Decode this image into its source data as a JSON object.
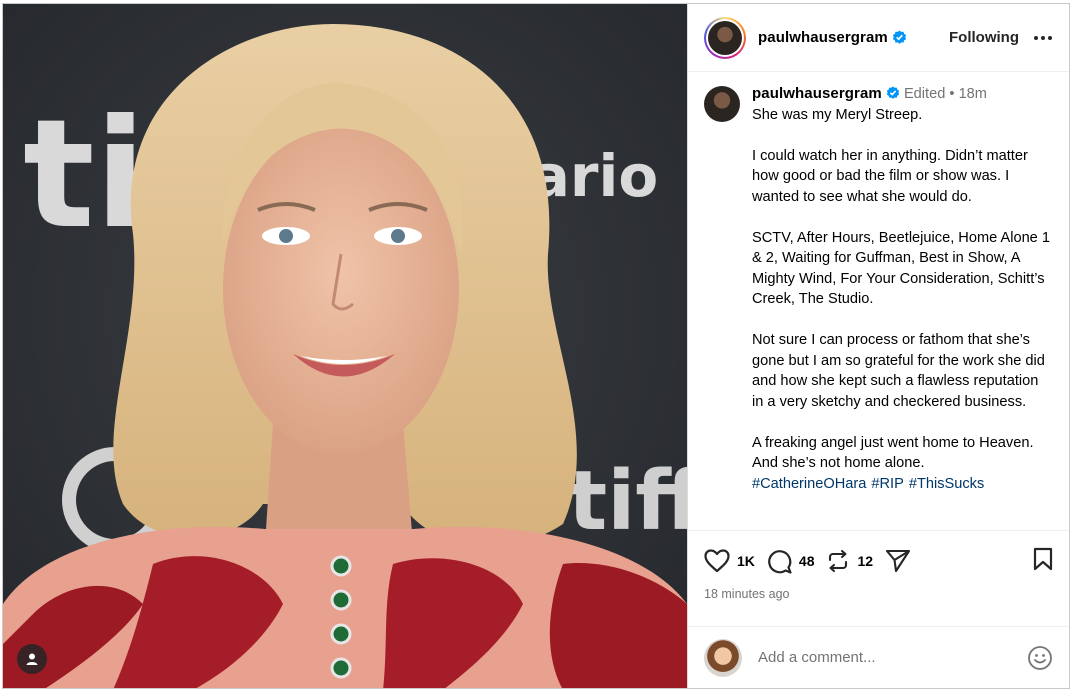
{
  "photo": {
    "backdrop_words": [
      "tiff",
      "tario",
      "tiff"
    ],
    "alt_icon": "user-tag-icon"
  },
  "header": {
    "username": "paulwhausergram",
    "follow_label": "Following",
    "icons": [
      "verified-badge-icon",
      "more-options-icon"
    ]
  },
  "post": {
    "username": "paulwhausergram",
    "edited": "Edited",
    "separator": "•",
    "age": "18m",
    "paragraphs": [
      "She was my Meryl Streep.",
      "I could watch her in anything. Didn’t matter how good or bad the film or show was. I wanted to see what she would do.",
      "SCTV, After Hours, Beetlejuice, Home Alone 1 & 2, Waiting for Guffman, Best in Show, A Mighty Wind, For Your Consideration, Schitt’s Creek, The Studio.",
      "Not sure I can process or fathom that she’s gone but I am so grateful for the work she did and how she kept such a flawless reputation in a very sketchy and checkered business.",
      "A freaking angel just went home to Heaven. And she’s not home alone."
    ],
    "hashtags": [
      "#CatherineOHara",
      "#RIP",
      "#ThisSucks"
    ]
  },
  "actions": {
    "likes": "1K",
    "comments": "48",
    "reposts": "12",
    "posted": "18 minutes ago",
    "icons": [
      "heart-icon",
      "comment-icon",
      "repost-icon",
      "share-icon",
      "bookmark-icon"
    ]
  },
  "comment": {
    "placeholder": "Add a comment...",
    "icon": "emoji-icon"
  }
}
